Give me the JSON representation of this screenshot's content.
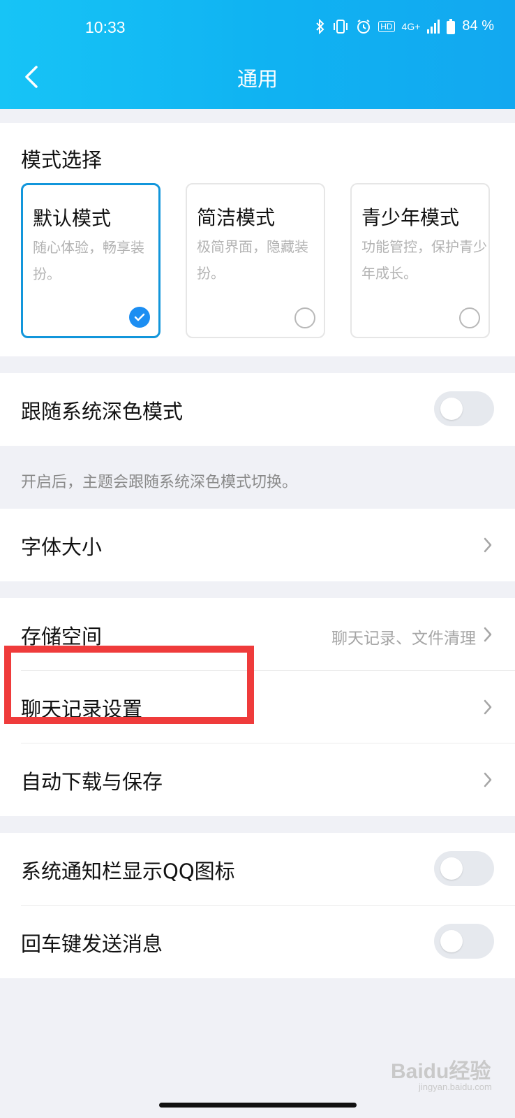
{
  "status": {
    "time": "10:33",
    "network": "4G+",
    "hd": "HD",
    "battery": "84 %"
  },
  "header": {
    "title": "通用"
  },
  "mode_section": {
    "title": "模式选择",
    "modes": [
      {
        "name": "默认模式",
        "desc": "随心体验，畅享装扮。",
        "selected": true
      },
      {
        "name": "简洁模式",
        "desc": "极简界面，隐藏装扮。",
        "selected": false
      },
      {
        "name": "青少年模式",
        "desc": "功能管控，保护青少年成长。",
        "selected": false
      }
    ]
  },
  "dark_mode": {
    "label": "跟随系统深色模式",
    "enabled": false,
    "hint": "开启后，主题会跟随系统深色模式切换。"
  },
  "font_size": {
    "label": "字体大小"
  },
  "storage": {
    "label": "存储空间",
    "value": "聊天记录、文件清理"
  },
  "chat_history": {
    "label": "聊天记录设置"
  },
  "auto_download": {
    "label": "自动下载与保存"
  },
  "notify_icon": {
    "label": "系统通知栏显示QQ图标",
    "enabled": false
  },
  "enter_send": {
    "label": "回车键发送消息",
    "enabled": false
  },
  "watermark": {
    "brand": "Baidu经验",
    "site": "jingyan.baidu.com"
  },
  "colors": {
    "header_start": "#17c4f6",
    "header_end": "#12a8f0",
    "accent": "#1c8ef2",
    "highlight": "#ef3b3b"
  }
}
